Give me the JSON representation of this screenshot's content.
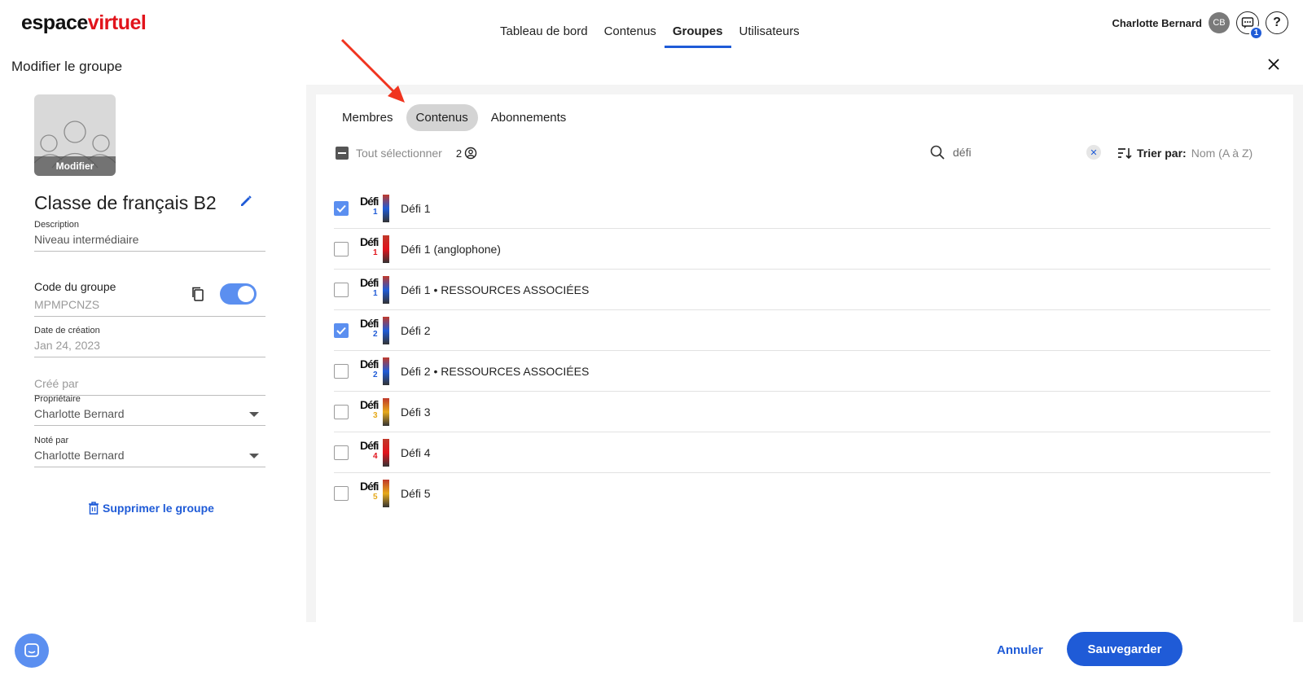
{
  "brand": {
    "part1": "espace",
    "part2": "virtuel"
  },
  "nav": [
    "Tableau de bord",
    "Contenus",
    "Groupes",
    "Utilisateurs"
  ],
  "user": {
    "name": "Charlotte Bernard",
    "initials": "CB",
    "notifications": "1",
    "help": "?"
  },
  "panel": {
    "title": "Modifier le groupe"
  },
  "group": {
    "image_edit_label": "Modifier",
    "name": "Classe de français B2",
    "description_label": "Description",
    "description": "Niveau intermédiaire",
    "code_label": "Code du groupe",
    "code": "MPMPCNZS",
    "date_label": "Date de création",
    "date": "Jan 24, 2023",
    "created_by_placeholder": "Créé par",
    "owner_label": "Propriétaire",
    "owner": "Charlotte Bernard",
    "graded_by_label": "Noté par",
    "graded_by": "Charlotte Bernard",
    "delete_label": "Supprimer le groupe"
  },
  "tabs": [
    "Membres",
    "Contenus",
    "Abonnements"
  ],
  "toolbar": {
    "select_all": "Tout sélectionner",
    "selected_count": "2",
    "search_value": "défi",
    "sort_label": "Trier par:",
    "sort_value": "Nom (A à Z)"
  },
  "items": [
    {
      "label": "Défi 1",
      "checked": true,
      "num": "1",
      "color": "#1f5bd7"
    },
    {
      "label": "Défi 1 (anglophone)",
      "checked": false,
      "num": "1",
      "color": "#e1141c"
    },
    {
      "label": "Défi 1 • RESSOURCES ASSOCIÉES",
      "checked": false,
      "num": "1",
      "color": "#1f5bd7"
    },
    {
      "label": "Défi 2",
      "checked": true,
      "num": "2",
      "color": "#1f5bd7"
    },
    {
      "label": "Défi 2 • RESSOURCES ASSOCIÉES",
      "checked": false,
      "num": "2",
      "color": "#1f5bd7"
    },
    {
      "label": "Défi 3",
      "checked": false,
      "num": "3",
      "color": "#e6a91a"
    },
    {
      "label": "Défi 4",
      "checked": false,
      "num": "4",
      "color": "#e1141c"
    },
    {
      "label": "Défi 5",
      "checked": false,
      "num": "5",
      "color": "#e6a91a"
    }
  ],
  "footer": {
    "cancel": "Annuler",
    "save": "Sauvegarder"
  }
}
